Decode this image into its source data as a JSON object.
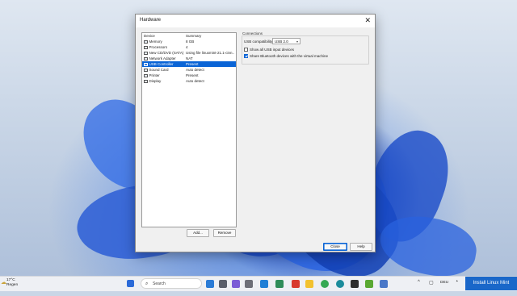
{
  "dialog": {
    "title": "Hardware",
    "close_glyph": "✕",
    "columns": {
      "device": "Device",
      "summary": "Summary"
    },
    "devices": [
      {
        "name": "Memory",
        "summary": "8 GB",
        "icon": "memory-icon",
        "selected": false
      },
      {
        "name": "Processors",
        "summary": "4",
        "icon": "processor-icon",
        "selected": false
      },
      {
        "name": "New CD/DVD (SATA)",
        "summary": "Using file linuxmint-21.1-cinn...",
        "icon": "cd-dvd-icon",
        "selected": false
      },
      {
        "name": "Network Adapter",
        "summary": "NAT",
        "icon": "network-icon",
        "selected": false
      },
      {
        "name": "USB Controller",
        "summary": "Present",
        "icon": "usb-icon",
        "selected": true
      },
      {
        "name": "Sound Card",
        "summary": "Auto detect",
        "icon": "sound-icon",
        "selected": false
      },
      {
        "name": "Printer",
        "summary": "Present",
        "icon": "printer-icon",
        "selected": false
      },
      {
        "name": "Display",
        "summary": "Auto detect",
        "icon": "display-icon",
        "selected": false
      }
    ],
    "add_label": "Add...",
    "remove_label": "Remove",
    "close_label": "Close",
    "help_label": "Help",
    "connections": {
      "group_label": "Connections",
      "usb_compat_label": "USB compatibility:",
      "usb_compat_value": "USB 2.0",
      "show_all_label": "Show all USB input devices",
      "show_all_checked": false,
      "share_bt_label": "Share Bluetooth devices with the virtual machine",
      "share_bt_checked": true
    }
  },
  "taskbar": {
    "weather_temp": "17°C",
    "weather_desc": "Regen",
    "search_placeholder": "Search",
    "language": "DEU",
    "accent": "#1a67c9"
  },
  "notification": {
    "label": "Install Linux Mint"
  }
}
